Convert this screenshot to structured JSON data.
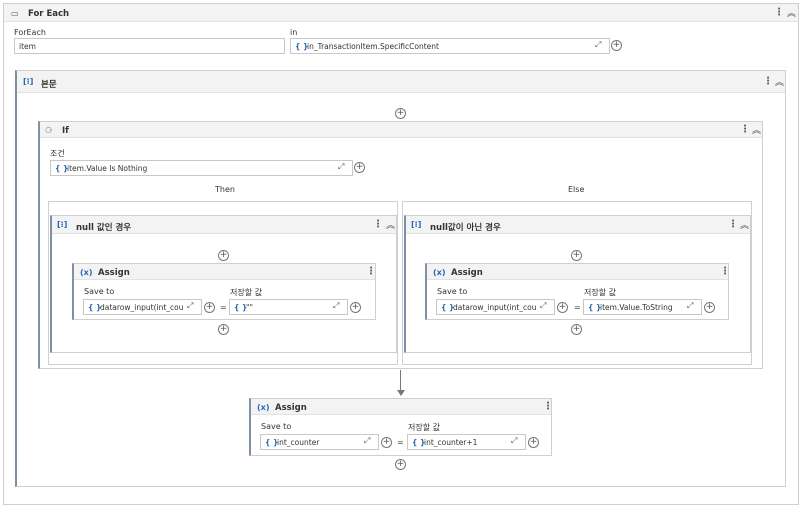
{
  "foreach": {
    "title": "For Each",
    "foreach_label": "ForEach",
    "item_value": "item",
    "in_label": "in",
    "in_value": "in_TransactionItem.SpecificContent"
  },
  "body": {
    "title": "본문"
  },
  "if_block": {
    "title": "If",
    "condition_label": "조건",
    "condition_value": "item.Value Is Nothing",
    "then_label": "Then",
    "else_label": "Else"
  },
  "then_seq": {
    "title": "null 값인 경우",
    "assign": {
      "title": "Assign",
      "save_to_label": "Save to",
      "value_label": "저장할 값",
      "save_to_value": "datarow_input(int_cou",
      "value": "\"\""
    }
  },
  "else_seq": {
    "title": "null값이 아닌 경우",
    "assign": {
      "title": "Assign",
      "save_to_label": "Save to",
      "value_label": "저장할 값",
      "save_to_value": "datarow_input(int_cou",
      "value": "item.Value.ToString"
    }
  },
  "counter_assign": {
    "title": "Assign",
    "save_to_label": "Save to",
    "value_label": "저장할 값",
    "save_to_value": "int_counter",
    "value": "int_counter+1"
  },
  "glyphs": {
    "expr": "{ }",
    "assign_icon": "(x)",
    "kebab": "⋮",
    "collapse": "︽",
    "expand": "⤢",
    "plus": "+",
    "eq": "="
  },
  "colors": {
    "accent": "#2a6ab7",
    "panel_header": "#f3f3f3",
    "border": "#cfcfcf"
  }
}
